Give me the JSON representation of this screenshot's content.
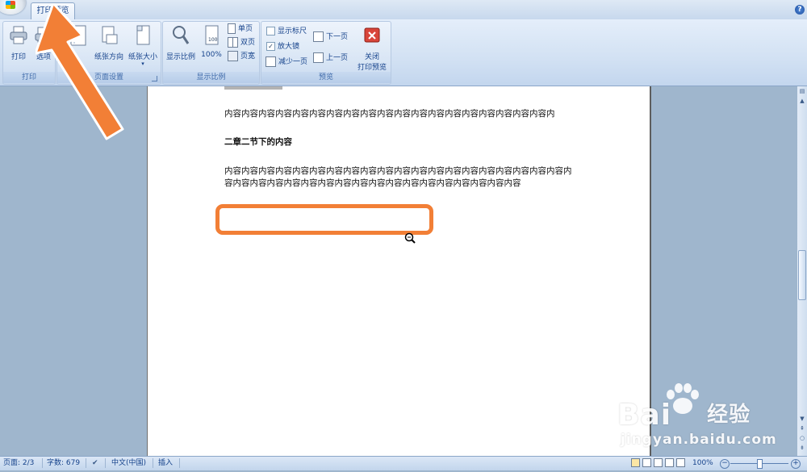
{
  "tabs": {
    "active": "打印预览"
  },
  "help_symbol": "?",
  "ribbon": {
    "print_group": {
      "label": "打印",
      "print_button": "打印",
      "options_button": "选项"
    },
    "page_setup_group": {
      "label": "页面设置",
      "orientation_button": "纸张方向",
      "size_button": "纸张大小"
    },
    "zoom_group": {
      "label": "显示比例",
      "zoom_button": "显示比例",
      "hundred_button": "100%",
      "one_page": "单页",
      "two_pages": "双页",
      "page_width": "页宽"
    },
    "preview_group": {
      "label": "预览",
      "show_ruler": "显示标尺",
      "magnifier": "放大镜",
      "shrink_one_page": "减少一页",
      "next_page": "下一页",
      "prev_page": "上一页",
      "close_line1": "关闭",
      "close_line2": "打印预览",
      "show_ruler_checked": false,
      "magnifier_checked": true
    }
  },
  "document": {
    "para1": "内容内容内容内容内容内容内容内容内容内容内容内容内容内容内容内容内容内容内容内",
    "heading": "二章二节下的内容",
    "para2": "内容内容内容内容内容内容内容内容内容内容内容内容内容内容内容内容内容内容内容内容内容内容内容内容内容内容内容内容内容内容内容内容内容内容内容内容内容内容"
  },
  "statusbar": {
    "page": "页面: 2/3",
    "words": "字数: 679",
    "language": "中文(中国)",
    "mode": "插入",
    "zoom": "100%"
  },
  "watermark": {
    "brand_latin": "Bai",
    "brand_cn": "经验",
    "url": "jingyan.baidu.com"
  },
  "colors": {
    "annotation": "#f27f36",
    "ribbon_text": "#15428b"
  }
}
